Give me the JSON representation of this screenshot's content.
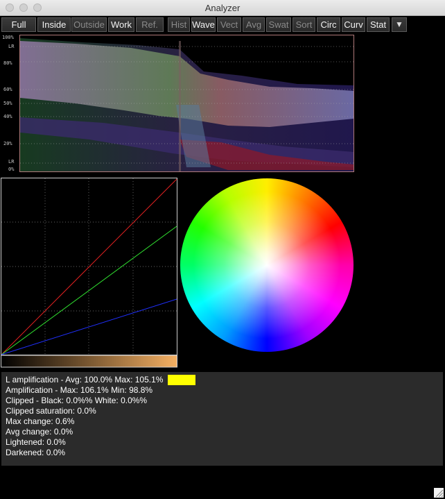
{
  "window": {
    "title": "Analyzer"
  },
  "toolbar": {
    "buttons": [
      {
        "label": "Full",
        "state": "on"
      },
      {
        "label": "Inside",
        "state": "on"
      },
      {
        "label": "Outside",
        "state": "off"
      },
      {
        "label": "Work",
        "state": "on"
      },
      {
        "label": "Ref.",
        "state": "off"
      },
      {
        "label": "Hist",
        "state": "off"
      },
      {
        "label": "Wave",
        "state": "on"
      },
      {
        "label": "Vect",
        "state": "off"
      },
      {
        "label": "Avg",
        "state": "off"
      },
      {
        "label": "Swat",
        "state": "off"
      },
      {
        "label": "Sort",
        "state": "off"
      },
      {
        "label": "Circ",
        "state": "on"
      },
      {
        "label": "Curv",
        "state": "on"
      },
      {
        "label": "Stat",
        "state": "on"
      }
    ],
    "menu_icon": "triangle-down-icon"
  },
  "waveform": {
    "labels": [
      "100%",
      "LR",
      "80%",
      "60%",
      "50%",
      "40%",
      "20%",
      "LR",
      "0%"
    ]
  },
  "stats": {
    "lines": [
      "L amplification - Avg: 100.0%  Max: 105.1%",
      "Amplification - Max: 106.1%  Min: 98.8%",
      "Clipped - Black: 0.0%%  White: 0.0%%",
      "Clipped saturation: 0.0%",
      "Max change: 0.6%",
      "Avg change: 0.0%",
      "Lightened: 0.0%",
      "Darkened: 0.0%"
    ],
    "swatch_color": "#ffff00"
  }
}
